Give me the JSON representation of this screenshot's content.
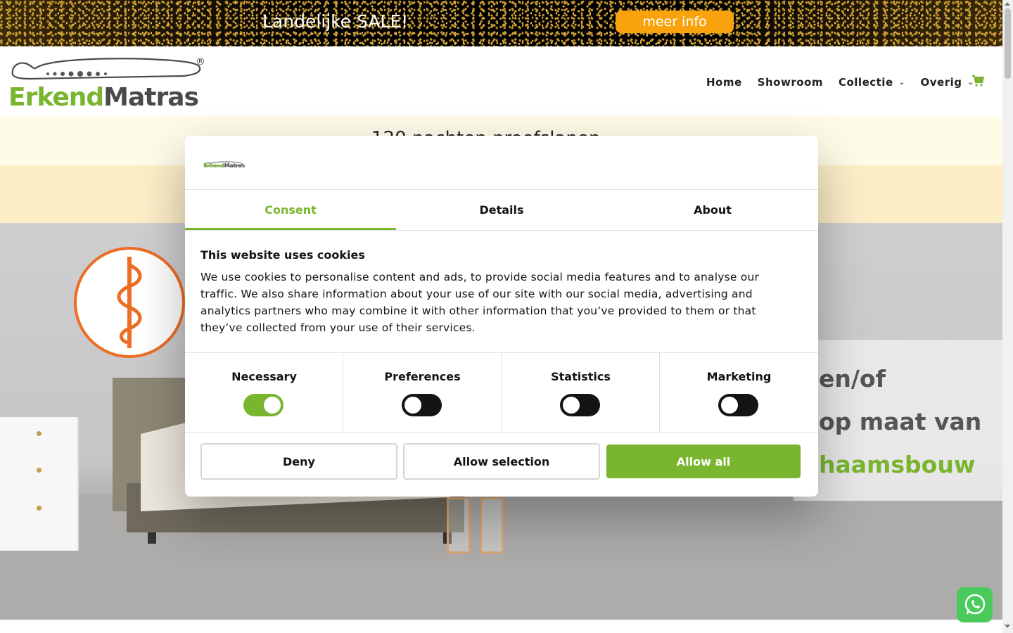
{
  "promo": {
    "title": "Landelijke SALE!",
    "button_label": "meer info",
    "button_color": "#f8a30e"
  },
  "header": {
    "logo": {
      "part1": "Erkend",
      "part2": "Matras",
      "registered": "®"
    },
    "nav": [
      {
        "label": "Home",
        "dropdown": false
      },
      {
        "label": "Showroom",
        "dropdown": false
      },
      {
        "label": "Collectie",
        "dropdown": true
      },
      {
        "label": "Overig",
        "dropdown": true
      }
    ],
    "cart_icon": "cart-icon"
  },
  "strip": {
    "partial_text": "120 nachten proefslapen"
  },
  "hero": {
    "lines": [
      "en/of",
      "op maat van",
      "haamsbouw"
    ]
  },
  "cookie_dialog": {
    "logo": {
      "part1": "Erkend",
      "part2": "Matras"
    },
    "tabs": [
      {
        "label": "Consent",
        "active": true
      },
      {
        "label": "Details",
        "active": false
      },
      {
        "label": "About",
        "active": false
      }
    ],
    "heading": "This website uses cookies",
    "body": "We use cookies to personalise content and ads, to provide social media features and to analyse our traffic. We also share information about your use of our site with our social media, advertising and analytics partners who may combine it with other information that you’ve provided to them or that they’ve collected from your use of their services.",
    "toggles": [
      {
        "label": "Necessary",
        "on": true
      },
      {
        "label": "Preferences",
        "on": false
      },
      {
        "label": "Statistics",
        "on": false
      },
      {
        "label": "Marketing",
        "on": false
      }
    ],
    "buttons": {
      "deny": "Deny",
      "allow_selection": "Allow selection",
      "allow_all": "Allow all"
    },
    "accent_color": "#7ab52f"
  },
  "whatsapp_icon": "whatsapp-icon"
}
